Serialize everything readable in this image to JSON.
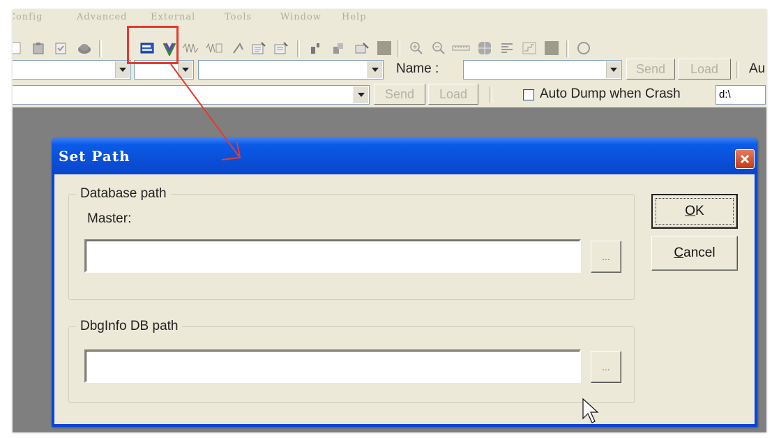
{
  "menubar": {
    "items": [
      "Config",
      "Advanced",
      "External",
      "Tools",
      "Window",
      "Help"
    ]
  },
  "toolbar": {
    "combo_row1": {
      "name_label": "Name :",
      "send_label": "Send",
      "load_label": "Load",
      "trailing_label": "Au"
    },
    "combo_row2": {
      "send_label": "Send",
      "load_label": "Load",
      "auto_dump_label": "Auto Dump when Crash",
      "auto_dump_checked": false,
      "dump_path_value": "d:\\"
    }
  },
  "dialog": {
    "title": "Set Path",
    "database_group": {
      "legend": "Database path",
      "master_label": "Master:",
      "master_value": "",
      "browse_label": "..."
    },
    "dbginfo_group": {
      "legend": "DbgInfo DB path",
      "value": "",
      "browse_label": "..."
    },
    "ok_label": "OK",
    "ok_mnemonic": "O",
    "ok_rest": "K",
    "cancel_label": "Cancel",
    "cancel_mnemonic": "C",
    "cancel_rest": "ancel"
  },
  "colors": {
    "title_bar": "#0a4fd8",
    "annotation": "#e53a2f",
    "dialog_face": "#ece9d8"
  }
}
